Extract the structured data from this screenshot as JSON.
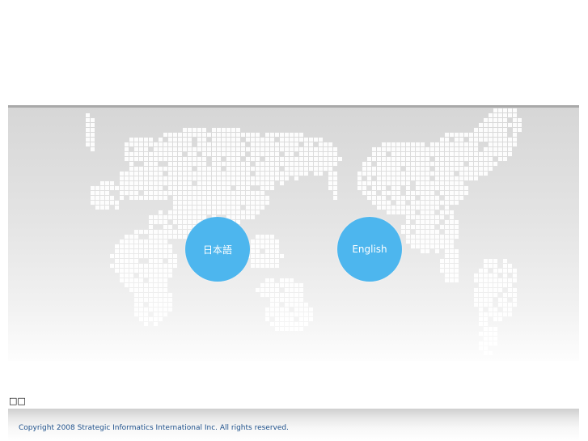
{
  "languages": {
    "japanese": "日本語",
    "english": "English"
  },
  "marker_text": "□□",
  "footer": {
    "copyright": "Copyright 2008 Strategic Informatics International Inc. All rights reserved."
  },
  "colors": {
    "button": "#4db6ee",
    "copyright_text": "#1c4f8a",
    "map_dots": "#ffffff"
  },
  "icons": {
    "background": "world-map-dots"
  }
}
